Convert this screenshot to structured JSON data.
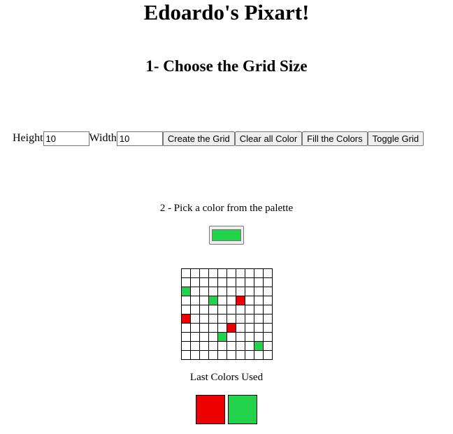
{
  "title": "Edoardo's Pixart!",
  "step1_heading": "1- Choose the Grid Size",
  "controls": {
    "height_label": "Height",
    "height_value": "10",
    "width_label": "Width",
    "width_value": "10",
    "create_button": "Create the Grid",
    "clear_button": "Clear all Color",
    "fill_button": "Fill the Colors",
    "toggle_button": "Toggle Grid"
  },
  "step2_label": "2 - Pick a color from the palette",
  "current_color": "#22d24b",
  "grid": {
    "rows": 10,
    "cols": 10,
    "painted_cells": [
      {
        "row": 2,
        "col": 0,
        "color": "#22d24b"
      },
      {
        "row": 3,
        "col": 3,
        "color": "#22d24b"
      },
      {
        "row": 3,
        "col": 6,
        "color": "#ee0000"
      },
      {
        "row": 5,
        "col": 0,
        "color": "#ee0000"
      },
      {
        "row": 6,
        "col": 5,
        "color": "#ee0000"
      },
      {
        "row": 7,
        "col": 4,
        "color": "#22d24b"
      },
      {
        "row": 8,
        "col": 8,
        "color": "#22d24b"
      }
    ]
  },
  "last_colors_label": "Last Colors Used",
  "last_colors": [
    "#ee0000",
    "#22d24b"
  ]
}
